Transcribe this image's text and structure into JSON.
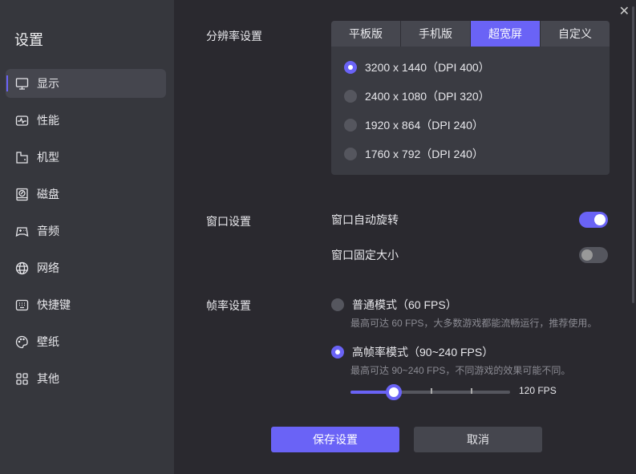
{
  "sidebar": {
    "title": "设置",
    "items": [
      {
        "label": "显示",
        "icon": "monitor-icon"
      },
      {
        "label": "性能",
        "icon": "pulse-icon"
      },
      {
        "label": "机型",
        "icon": "device-icon"
      },
      {
        "label": "磁盘",
        "icon": "disk-icon"
      },
      {
        "label": "音频",
        "icon": "gamepad-icon"
      },
      {
        "label": "网络",
        "icon": "globe-icon"
      },
      {
        "label": "快捷键",
        "icon": "keyboard-icon"
      },
      {
        "label": "壁纸",
        "icon": "palette-icon"
      },
      {
        "label": "其他",
        "icon": "grid-icon"
      }
    ],
    "active": 0
  },
  "resolution": {
    "label": "分辨率设置",
    "tabs": [
      "平板版",
      "手机版",
      "超宽屏",
      "自定义"
    ],
    "active_tab": 2,
    "options": [
      "3200 x 1440（DPI 400）",
      "2400 x 1080（DPI 320）",
      "1920 x 864（DPI 240）",
      "1760 x 792（DPI 240）"
    ],
    "selected": 0
  },
  "window": {
    "label": "窗口设置",
    "auto_rotate": {
      "label": "窗口自动旋转",
      "on": true
    },
    "fixed_size": {
      "label": "窗口固定大小",
      "on": false
    }
  },
  "framerate": {
    "label": "帧率设置",
    "normal": {
      "label": "普通模式（60 FPS）",
      "desc": "最高可达 60 FPS，大多数游戏都能流畅运行，推荐使用。",
      "selected": false
    },
    "high": {
      "label": "高帧率模式（90~240 FPS）",
      "desc": "最高可达 90~240 FPS，不同游戏的效果可能不同。",
      "selected": true
    },
    "slider": {
      "value_fraction": 0.27,
      "value_label": "120 FPS"
    }
  },
  "buttons": {
    "save": "保存设置",
    "cancel": "取消"
  },
  "colors": {
    "accent": "#6a63f6"
  }
}
